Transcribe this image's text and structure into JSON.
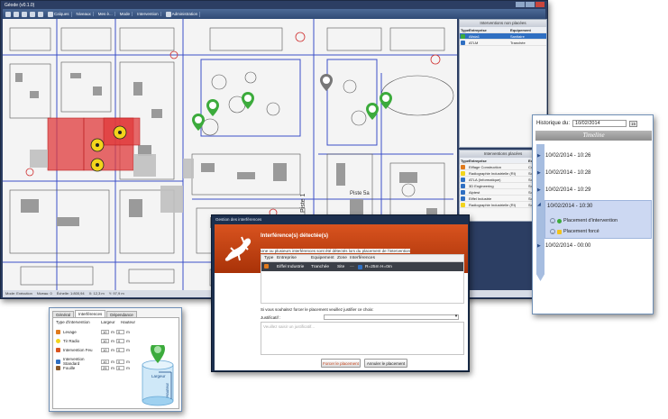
{
  "main_window": {
    "title": "Géode (v0.1.0)",
    "toolbar": [
      "Calques",
      "Niveaux",
      "Mes è...",
      "Mode",
      "Intervention",
      "Administration"
    ],
    "status": [
      "Mode: Exécution",
      "Niveau: 0",
      "Échelle: 1:800,94",
      "X: 12,3 m",
      "Y: 97,9 m"
    ],
    "map_labels": [
      "Piste 1",
      "Piste 5a"
    ]
  },
  "interventions_non_placees": {
    "title": "Interventions non placées",
    "columns": [
      "Type",
      "Entreprise",
      "Equipement"
    ],
    "rows": [
      {
        "entreprise": "Allsta1",
        "equipement": "Sanitaire",
        "selected": true
      },
      {
        "entreprise": "ATLM",
        "equipement": "Tranchée",
        "selected": false
      }
    ]
  },
  "interventions_placees": {
    "title": "Interventions placées",
    "columns": [
      "Type",
      "Entreprise",
      "Equip"
    ],
    "rows": [
      {
        "entreprise": "Eiffage Construction",
        "equip": "Coo"
      },
      {
        "entreprise": "Radiographie Industrielle (RI)",
        "equip": "Sou"
      },
      {
        "entreprise": "ATLA (Informatique)",
        "equip": "Sou"
      },
      {
        "entreprise": "3D Engineering",
        "equip": "Sou"
      },
      {
        "entreprise": "Alptest",
        "equip": "Sou"
      },
      {
        "entreprise": "Eiffel Industrie",
        "equip": "Sou"
      },
      {
        "entreprise": "Radiographie Industrielle (RI)",
        "equip": "Sou"
      }
    ]
  },
  "timeline": {
    "history_label": "Historique du:",
    "history_date": "10/02/2014",
    "calendar_label": "15",
    "header": "Timeline",
    "entries": [
      "10/02/2014 - 10:26",
      "10/02/2014 - 10:28",
      "10/02/2014 - 10:29",
      "10/02/2014 - 10:30",
      "10/02/2014 - 00:00"
    ],
    "sub_items": [
      "Placement d'intervention",
      "Placement forcé"
    ]
  },
  "parameters": {
    "tabs": [
      "Général",
      "Interférences",
      "Dépendance"
    ],
    "columns": [
      "Type d'intervention",
      "Largeur",
      "Hauteur"
    ],
    "rows": [
      {
        "name": "Levage",
        "largeur": "10",
        "hauteur": "0"
      },
      {
        "name": "Tir Radio",
        "largeur": "10",
        "hauteur": "0"
      },
      {
        "name": "Intervention Feu",
        "largeur": "10",
        "hauteur": "0"
      },
      {
        "name": "Intervention Standard",
        "largeur": "10",
        "hauteur": "0"
      },
      {
        "name": "Fouille",
        "largeur": "25",
        "hauteur": "0"
      }
    ],
    "unit": "m",
    "diagram_labels": [
      "Largeur",
      "Hauteur"
    ]
  },
  "dialog": {
    "title": "Gestion des interférences",
    "heading": "Interférence(s) détectée(s)",
    "text": "Une ou plusieurs interférences sont été détectés lors du placement de l'intervention",
    "columns": [
      "Type",
      "Entreprise",
      "Equipement",
      "Zone",
      "Interférences"
    ],
    "row": {
      "entreprise": "Eiffel Industrie",
      "equipement": "Tranchée",
      "zone": "Site",
      "interference": "R=25m H=0m"
    },
    "question": "Si vous souhaitez forcer le placement veuillez justifier ce choix:",
    "justificatif_label": "Justificatif :",
    "placeholder": "Veuillez saisir un justificatif...",
    "buttons": {
      "force": "Forcer le placement",
      "cancel": "Annuler le placement"
    }
  },
  "colors": {
    "accent": "#2f6fc2",
    "dialog_header": "#c4421a",
    "hazard": "#e0393b"
  }
}
